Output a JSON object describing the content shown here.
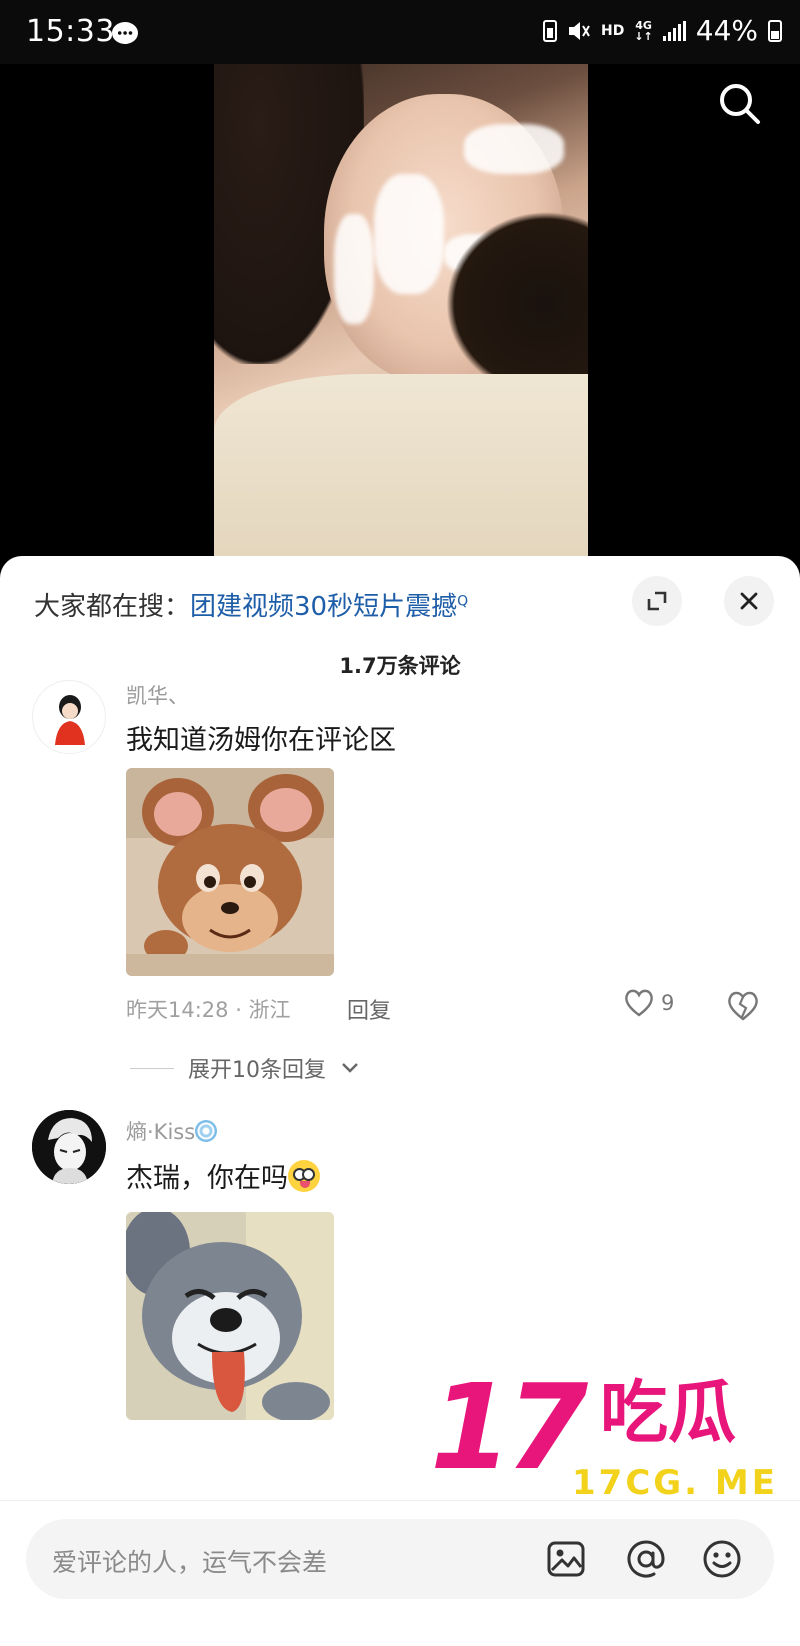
{
  "status_bar": {
    "time": "15:33",
    "hd": "HD",
    "network": "4G",
    "battery": "44%",
    "battery_level": 0.44
  },
  "sheet": {
    "hot_search_label": "大家都在搜：",
    "hot_search_term": "团建视频30秒短片震撼",
    "comment_count": "1.7万条评论"
  },
  "comments": [
    {
      "username": "凯华、",
      "text": "我知道汤姆你在评论区",
      "meta": "昨天14:28 · 浙江",
      "reply_label": "回复",
      "likes": "9",
      "expand_label": "展开10条回复"
    },
    {
      "username": "熵·Kiss",
      "text": "杰瑞，你在吗"
    }
  ],
  "input_bar": {
    "placeholder": "爱评论的人，运气不会差"
  },
  "watermark": {
    "number": "17",
    "cn": "吃瓜",
    "site": "17CG. ME"
  },
  "colors": {
    "accent_link": "#1e5ea8",
    "watermark_pink": "#e8157a",
    "watermark_yellow": "#f2d21a"
  }
}
